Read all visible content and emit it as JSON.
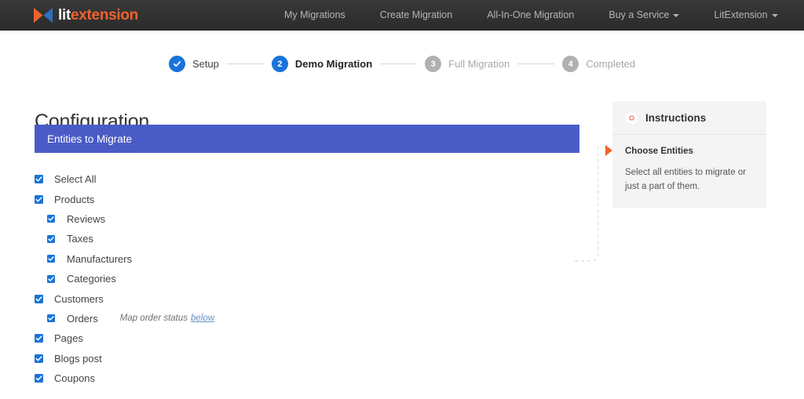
{
  "header": {
    "logo": {
      "icon": "litextension-bowtie-logo",
      "text_first": "lit",
      "text_second": "extension"
    },
    "nav": [
      {
        "label": "My Migrations",
        "has_caret": false
      },
      {
        "label": "Create Migration",
        "has_caret": false
      },
      {
        "label": "All-In-One Migration",
        "has_caret": false
      },
      {
        "label": "Buy a Service",
        "has_caret": true
      },
      {
        "label": "LitExtension",
        "has_caret": true
      }
    ]
  },
  "stepper": {
    "steps": [
      {
        "number": "1",
        "label": "Setup",
        "state": "done",
        "icon": "check-icon"
      },
      {
        "number": "2",
        "label": "Demo Migration",
        "state": "active"
      },
      {
        "number": "3",
        "label": "Full Migration",
        "state": "todo"
      },
      {
        "number": "4",
        "label": "Completed",
        "state": "todo"
      }
    ]
  },
  "main": {
    "page_title": "Configuration",
    "section_bar_label": "Entities to Migrate",
    "entities": [
      {
        "label": "Select All",
        "checked": true,
        "level": 0
      },
      {
        "label": "Products",
        "checked": true,
        "level": 0
      },
      {
        "label": "Reviews",
        "checked": true,
        "level": 1
      },
      {
        "label": "Taxes",
        "checked": true,
        "level": 1
      },
      {
        "label": "Manufacturers",
        "checked": true,
        "level": 1
      },
      {
        "label": "Categories",
        "checked": true,
        "level": 1
      },
      {
        "label": "Customers",
        "checked": true,
        "level": 0
      },
      {
        "label": "Orders",
        "checked": true,
        "level": 1,
        "hint_text": "Map order status",
        "hint_link": "below"
      },
      {
        "label": "Pages",
        "checked": true,
        "level": 0
      },
      {
        "label": "Blogs post",
        "checked": true,
        "level": 0
      },
      {
        "label": "Coupons",
        "checked": true,
        "level": 0
      }
    ]
  },
  "instructions": {
    "icon": "lifebuoy-icon",
    "title": "Instructions",
    "item_title": "Choose Entities",
    "item_text": "Select all entities to migrate or just a part of them."
  },
  "colors": {
    "header_bg": "#2e2e2e",
    "brand_orange": "#f2622b",
    "brand_blue": "#2f6fc0",
    "accent_blue": "#1a73d9",
    "section_bar": "#4a5bc6",
    "panel_bg": "#f4f4f4",
    "step_todo": "#b0b0b0"
  }
}
